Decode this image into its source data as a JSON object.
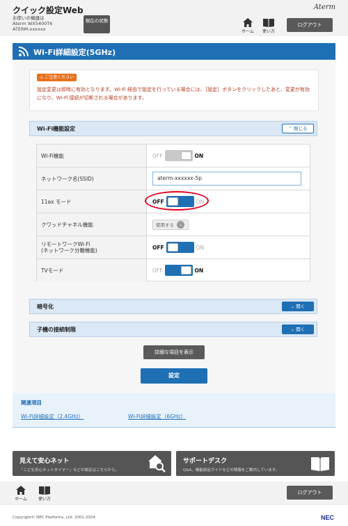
{
  "header": {
    "app_title": "クイック設定Web",
    "device_label": "お使いの機器は",
    "device_model": "Aterm WX5400T6",
    "device_name": "ATERM-xxxxxx",
    "status_button": "現在の状態",
    "brand": "Aterm",
    "home_label": "ホーム",
    "manual_label": "使い方",
    "logout_label": "ログアウト"
  },
  "page": {
    "title": "Wi-Fi詳細設定(5GHz)"
  },
  "notice": {
    "badge": "ご注意ください",
    "text": "設定変更は即時に有効となります。Wi-Fi 経由で設定を行っている場合には、［設定］ボタンをクリックしたあと、変更が有効になり、Wi-Fi 接続が切断される場合があります。"
  },
  "wifi_section": {
    "title": "Wi-Fi機能設定",
    "toggle_label": "閉じる",
    "rows": [
      {
        "label": "Wi-Fi機能",
        "type": "switch",
        "state": "on",
        "off_text": "OFF",
        "on_text": "ON"
      },
      {
        "label": "ネットワーク名(SSID)",
        "type": "input",
        "value": "aterm-xxxxxx-5p"
      },
      {
        "label": "11ax モード",
        "type": "switch",
        "state": "off",
        "off_text": "OFF",
        "on_text": "ON"
      },
      {
        "label": "クワッドチャネル機能",
        "type": "select",
        "value": "使用する"
      },
      {
        "label": "リモートワークWi-Fi",
        "label2": "(ネットワーク分離機能)",
        "type": "switch",
        "state": "off",
        "off_text": "OFF",
        "on_text": "ON"
      },
      {
        "label": "TVモード",
        "type": "switch",
        "state": "on",
        "off_text": "OFF",
        "on_text": "ON"
      }
    ]
  },
  "encryption_section": {
    "title": "暗号化",
    "toggle_label": "開く"
  },
  "child_section": {
    "title": "子機の接続制限",
    "toggle_label": "開く"
  },
  "buttons": {
    "show_details": "詳細な項目を表示",
    "apply": "設定"
  },
  "related": {
    "title": "関連項目",
    "links": [
      "Wi-Fi詳細設定（2.4GHz）",
      "Wi-Fi詳細設定（6GHz）"
    ]
  },
  "banners": {
    "left_title": "見えて安心ネット",
    "left_sub": "「こども安心ネットタイマー」などの設定はこちらから。",
    "right_title": "サポートデスク",
    "right_sub": "Q&A、機能設定ガイドなどの情報をご案内しています。"
  },
  "footer": {
    "home_label": "ホーム",
    "manual_label": "使い方",
    "logout_label": "ログアウト",
    "copyright": "Copyright© NEC Platforms, Ltd. 2001-2024",
    "logo": "NEC"
  },
  "colors": {
    "primary": "#1f6fb5",
    "notice": "#e8701d",
    "highlight_ring": "#e3001f"
  }
}
